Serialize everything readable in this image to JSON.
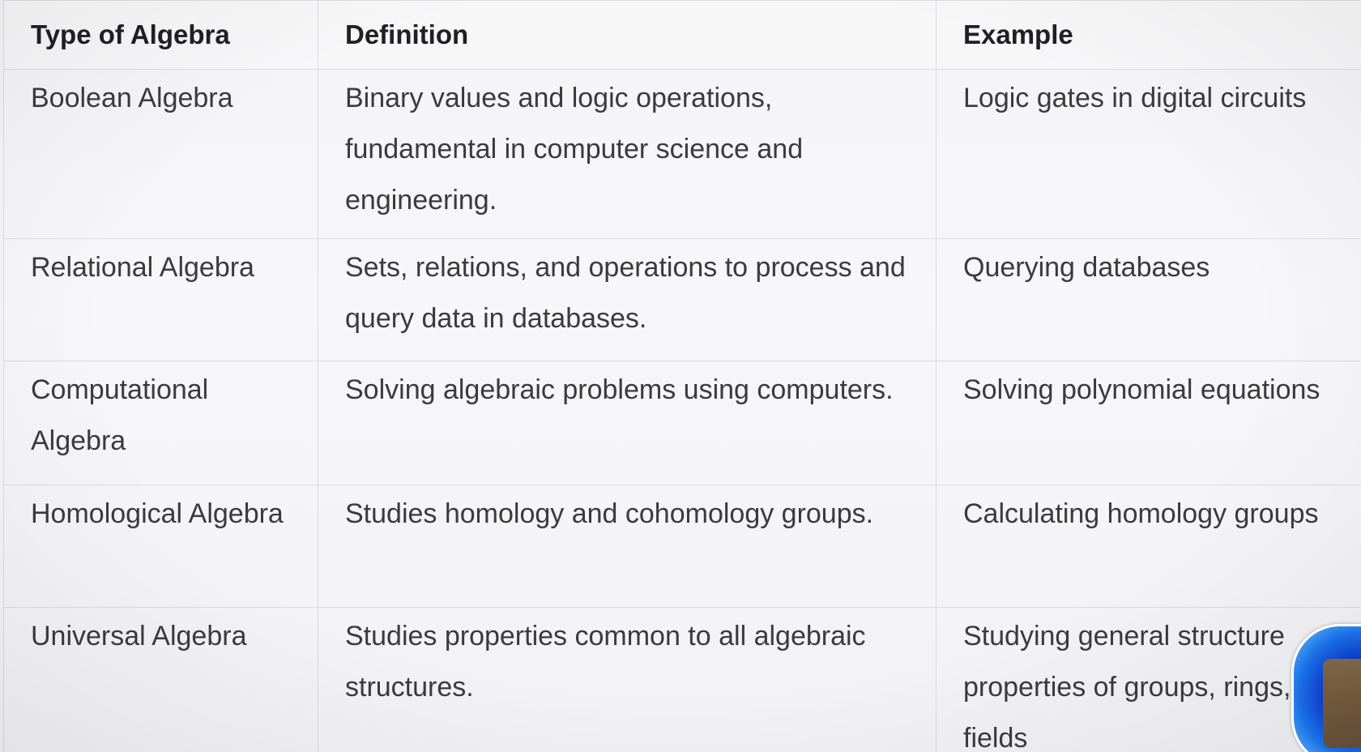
{
  "table": {
    "headers": [
      "Type of Algebra",
      "Definition",
      "Example"
    ],
    "rows": [
      {
        "type": "Boolean Algebra",
        "definition": "Binary values and logic operations, fundamental in computer science and engineering.",
        "example": "Logic gates in digital circuits"
      },
      {
        "type": "Relational Algebra",
        "definition": "Sets, relations, and operations to process and query data in databases.",
        "example": "Querying databases"
      },
      {
        "type": "Computational Algebra",
        "definition": "Solving algebraic problems using computers.",
        "example": "Solving polynomial equations"
      },
      {
        "type": "Homological Algebra",
        "definition": "Studies homology and cohomology groups.",
        "example": "Calculating homology groups"
      },
      {
        "type": "Universal Algebra",
        "definition": "Studies properties common to all algebraic structures.",
        "example": "Studying general structure properties of groups, rings, and fields"
      }
    ]
  }
}
